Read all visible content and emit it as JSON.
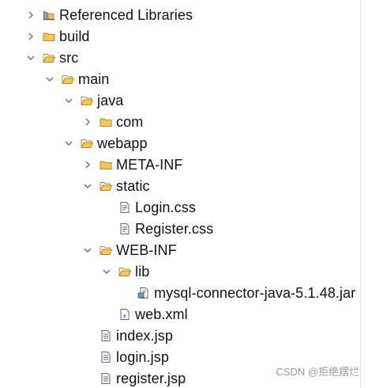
{
  "tree": [
    {
      "label": "Referenced Libraries",
      "icon": "library-icon",
      "chevron": "right",
      "level": 0
    },
    {
      "label": "build",
      "icon": "folder-icon",
      "chevron": "right",
      "level": 0
    },
    {
      "label": "src",
      "icon": "folder-open-icon",
      "chevron": "down",
      "level": 0
    },
    {
      "label": "main",
      "icon": "folder-open-icon",
      "chevron": "down",
      "level": 1
    },
    {
      "label": "java",
      "icon": "folder-open-icon",
      "chevron": "down",
      "level": 2
    },
    {
      "label": "com",
      "icon": "folder-icon",
      "chevron": "right",
      "level": 3
    },
    {
      "label": "webapp",
      "icon": "folder-open-icon",
      "chevron": "down",
      "level": 2
    },
    {
      "label": "META-INF",
      "icon": "folder-icon",
      "chevron": "right",
      "level": 3
    },
    {
      "label": "static",
      "icon": "folder-open-icon",
      "chevron": "down",
      "level": 3
    },
    {
      "label": "Login.css",
      "icon": "css-file-icon",
      "chevron": "none",
      "level": 4
    },
    {
      "label": "Register.css",
      "icon": "css-file-icon",
      "chevron": "none",
      "level": 4
    },
    {
      "label": "WEB-INF",
      "icon": "folder-open-icon",
      "chevron": "down",
      "level": 3
    },
    {
      "label": "lib",
      "icon": "folder-open-icon",
      "chevron": "down",
      "level": 4
    },
    {
      "label": "mysql-connector-java-5.1.48.jar",
      "icon": "jar-file-icon",
      "chevron": "none",
      "level": 5
    },
    {
      "label": "web.xml",
      "icon": "xml-file-icon",
      "chevron": "none",
      "level": 4
    },
    {
      "label": "index.jsp",
      "icon": "jsp-file-icon",
      "chevron": "none",
      "level": 3
    },
    {
      "label": "login.jsp",
      "icon": "jsp-file-icon",
      "chevron": "none",
      "level": 3
    },
    {
      "label": "register.jsp",
      "icon": "jsp-file-icon",
      "chevron": "none",
      "level": 3
    }
  ],
  "watermark": "CSDN @拒绝摆烂",
  "colors": {
    "folder_fill": "#f0c75e",
    "folder_stroke": "#b88a1b",
    "chevron": "#6f6f6f",
    "file_stroke": "#5a6b80",
    "text": "#111111"
  }
}
